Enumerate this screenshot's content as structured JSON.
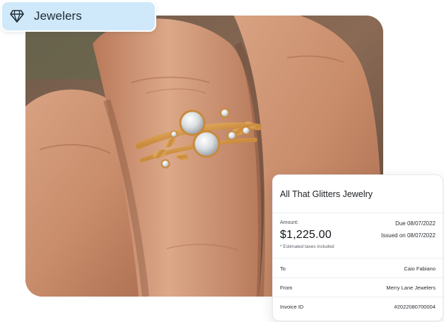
{
  "category": {
    "label": "Jewelers",
    "icon": "diamond-icon",
    "accent": "#cfe9fb"
  },
  "photo": {
    "icon": "ring-on-hand-photo"
  },
  "invoice": {
    "merchant": "All That Glitters Jewelry",
    "amount_label": "Amount:",
    "amount": "$1,225.00",
    "tax_note": "* Estimated taxes included",
    "due": "Due 08/07/2022",
    "issued": "Issued on 08/07/2022",
    "rows": [
      {
        "label": "To",
        "value": "Caio Fabiano"
      },
      {
        "label": "From",
        "value": "Merry Lane Jewelers"
      },
      {
        "label": "Invoice ID",
        "value": "#2022080700004"
      }
    ]
  }
}
